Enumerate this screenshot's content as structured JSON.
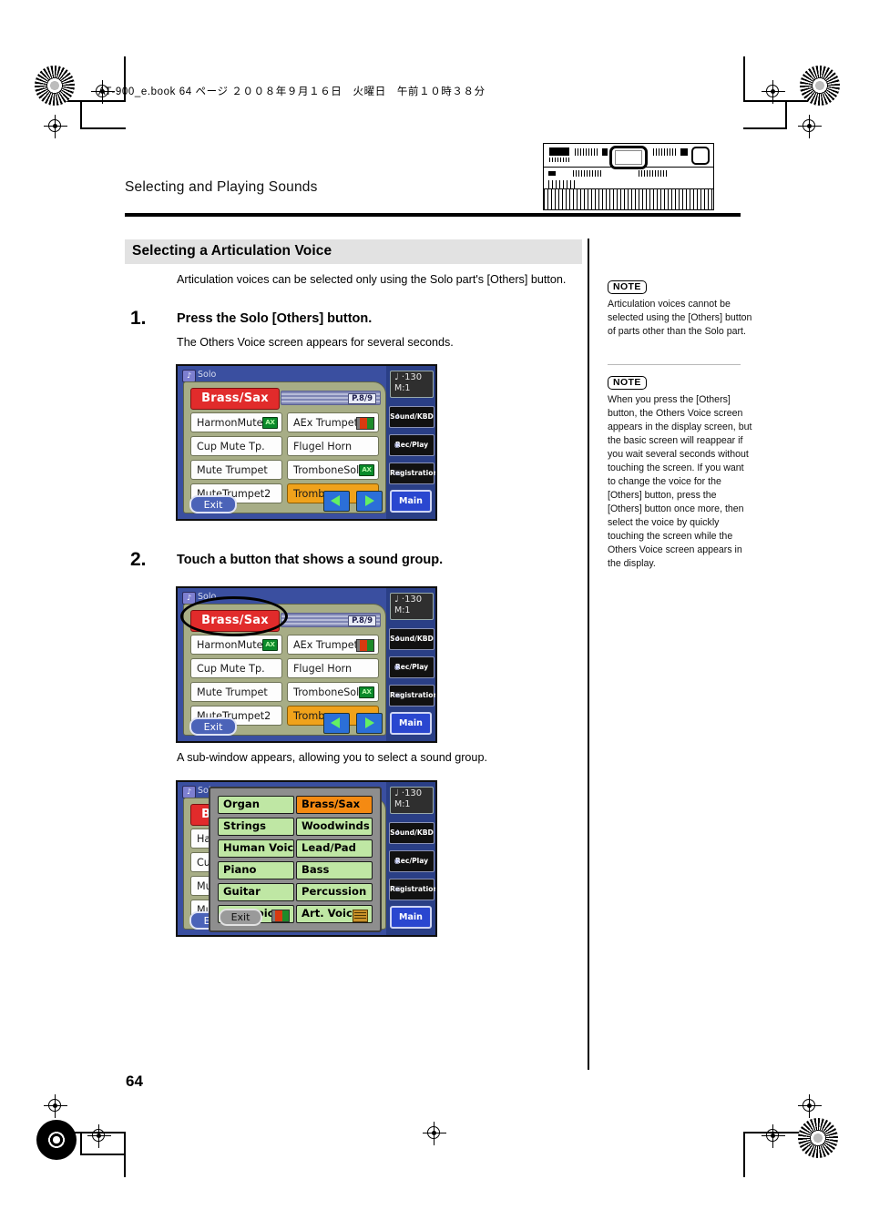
{
  "print": {
    "file_stamp": "AT-900_e.book 64 ページ ２００８年９月１６日　火曜日　午前１０時３８分",
    "page_number": "64"
  },
  "header": {
    "running_head": "Selecting and Playing Sounds",
    "organ_thumbnail_alt": "AT-900 organ panel diagram with display highlighted"
  },
  "section": {
    "title": "Selecting a Articulation Voice",
    "intro": "Articulation voices can be selected only using the Solo part's [Others] button."
  },
  "steps": [
    {
      "num": "1.",
      "title": "Press the Solo [Others] button.",
      "body": "The Others Voice screen appears for several seconds."
    },
    {
      "num": "2.",
      "title": "Touch a button that shows a sound group.",
      "body": "A sub-window appears, allowing you to select a sound group."
    }
  ],
  "notes": [
    {
      "tag": "NOTE",
      "text": "Articulation voices cannot be selected using the [Others] button of parts other than the Solo part."
    },
    {
      "tag": "NOTE",
      "text": "When you press the [Others] button, the Others Voice screen appears in the display screen, but the basic screen will reappear if you wait several seconds without touching the screen. If you want to change the voice for the [Others] button, press the [Others] button once more, then select the voice by quickly touching the screen while the Others Voice screen appears in the display."
    }
  ],
  "lcd": {
    "title": "Solo",
    "group_button": "Brass/Sax",
    "page_tag": "P.8/9",
    "exit_label": "Exit",
    "arrow_left": "prev-page-arrow",
    "arrow_right": "next-page-arrow",
    "voices": [
      {
        "label": "HarmonMuteTp",
        "badge": "AX",
        "selected": false
      },
      {
        "label": "AEx Trumpet",
        "badge": "aex",
        "selected": false
      },
      {
        "label": "Cup Mute Tp.",
        "badge": "",
        "selected": false
      },
      {
        "label": "Flugel Horn",
        "badge": "",
        "selected": false
      },
      {
        "label": "Mute Trumpet",
        "badge": "",
        "selected": false
      },
      {
        "label": "TromboneSolo",
        "badge": "AX",
        "selected": false
      },
      {
        "label": "MuteTrumpet2",
        "badge": "",
        "selected": false
      },
      {
        "label": "Trombone",
        "badge": "",
        "selected": true
      }
    ],
    "strip": {
      "tempo_value": "♩ ·130",
      "measure_label": "M:",
      "measure_value": "1",
      "buttons": [
        {
          "label": "Sound/KBD",
          "icon": "note-icon"
        },
        {
          "label": "Rec/Play",
          "icon": "speaker-icon"
        },
        {
          "label": "Registration",
          "icon": "hand-icon"
        }
      ],
      "main_label": "Main"
    }
  },
  "subwindow": {
    "exit_label": "Exit",
    "groups": [
      {
        "label": "Organ",
        "selected": false,
        "icon": ""
      },
      {
        "label": "Brass/Sax",
        "selected": true,
        "icon": ""
      },
      {
        "label": "Strings",
        "selected": false,
        "icon": ""
      },
      {
        "label": "Woodwinds",
        "selected": false,
        "icon": ""
      },
      {
        "label": "Human Voice",
        "selected": false,
        "icon": ""
      },
      {
        "label": "Lead/Pad",
        "selected": false,
        "icon": ""
      },
      {
        "label": "Piano",
        "selected": false,
        "icon": ""
      },
      {
        "label": "Bass",
        "selected": false,
        "icon": ""
      },
      {
        "label": "Guitar",
        "selected": false,
        "icon": ""
      },
      {
        "label": "Percussion",
        "selected": false,
        "icon": ""
      },
      {
        "label": "AEx Voice",
        "selected": false,
        "icon": "aex"
      },
      {
        "label": "Art. Voice",
        "selected": false,
        "icon": "art"
      }
    ]
  },
  "colors": {
    "lcd_bg": "#3a4fa0",
    "panel": "#a7ad86",
    "selected_red": "#e12b2b",
    "selected_orange": "#f0a21b",
    "group_green": "#bfe7a4",
    "main_blue": "#2a47d0"
  }
}
